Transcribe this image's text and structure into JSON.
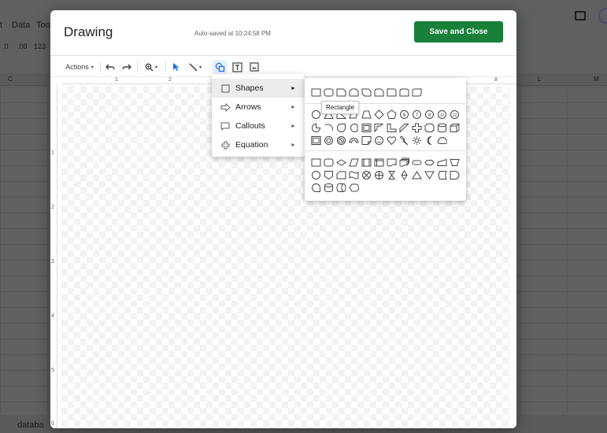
{
  "background": {
    "menubar": [
      "t",
      "Data",
      "Too"
    ],
    "toolbar": [
      ".0",
      ".00",
      "123"
    ],
    "columns": [
      "C",
      "L",
      "M"
    ],
    "sheet_tab": "databa"
  },
  "dialog": {
    "title": "Drawing",
    "autosave": "Auto-saved at 10:24:58 PM",
    "save_label": "Save and Close",
    "accent": "#188038"
  },
  "toolbar": {
    "actions_label": "Actions",
    "icons": [
      "undo-icon",
      "redo-icon",
      "zoom-icon",
      "select-icon",
      "line-icon",
      "shape-icon",
      "textbox-icon",
      "image-icon"
    ]
  },
  "ruler": {
    "top": [
      "1",
      "2",
      "8"
    ],
    "left": [
      "1",
      "2",
      "3",
      "4",
      "5",
      "6"
    ]
  },
  "menu": {
    "items": [
      {
        "label": "Shapes",
        "icon": "square-icon"
      },
      {
        "label": "Arrows",
        "icon": "arrow-icon"
      },
      {
        "label": "Callouts",
        "icon": "callout-icon"
      },
      {
        "label": "Equation",
        "icon": "equation-icon"
      }
    ]
  },
  "submenu": {
    "tooltip": "Rectangle"
  }
}
